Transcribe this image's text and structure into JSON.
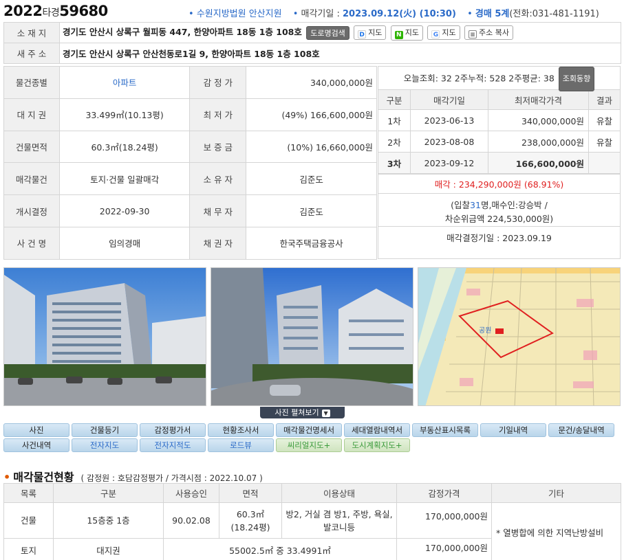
{
  "header": {
    "case_year": "2022",
    "case_type": "타경",
    "case_no": "59680",
    "court": "수원지방법원 안산지원",
    "sale_date_label": "매각기일 : ",
    "sale_date": "2023.09.12(火) (10:30)",
    "dept": "경매 5계",
    "phone": "(전화:031-481-1191)"
  },
  "address": {
    "location_label": "소 재 지",
    "location": "경기도 안산시 상록구 월피동 447, 한양아파트 18동 1층 108호",
    "btn_road": "도로명검색",
    "btn_daum": "지도",
    "btn_naver": "지도",
    "btn_google": "지도",
    "btn_copy": "주소 복사",
    "new_label": "새 주 소",
    "new_address": "경기도 안산시 상록구 안산천동로1길 9, 한양아파트 18동 1층 108호"
  },
  "info": {
    "rows": [
      {
        "l1": "물건종별",
        "v1": "아파트",
        "l2": "감 정 가",
        "v2": "340,000,000원"
      },
      {
        "l1": "대 지 권",
        "v1": "33.499㎡(10.13평)",
        "l2": "최 저 가",
        "v2": "(49%) 166,600,000원"
      },
      {
        "l1": "건물면적",
        "v1": "60.3㎡(18.24평)",
        "l2": "보 증 금",
        "v2": "(10%) 16,660,000원"
      },
      {
        "l1": "매각물건",
        "v1": "토지·건물 일괄매각",
        "l2": "소 유 자",
        "v2": "김준도"
      },
      {
        "l1": "개시결정",
        "v1": "2022-09-30",
        "l2": "채 무 자",
        "v2": "김준도"
      },
      {
        "l1": "사 건 명",
        "v1": "임의경매",
        "l2": "채 권 자",
        "v2": "한국주택금융공사"
      }
    ]
  },
  "views": {
    "text": "오늘조회: 32  2주누적: 528  2주평균: 38",
    "btn": "조회동향"
  },
  "rounds": {
    "headers": [
      "구분",
      "매각기일",
      "최저매각가격",
      "결과"
    ],
    "rows": [
      {
        "round": "1차",
        "date": "2023-06-13",
        "price": "340,000,000원",
        "result": "유찰"
      },
      {
        "round": "2차",
        "date": "2023-08-08",
        "price": "238,000,000원",
        "result": "유찰"
      },
      {
        "round": "3차",
        "date": "2023-09-12",
        "price": "166,600,000원",
        "result": ""
      }
    ]
  },
  "sale": {
    "label": "매각 : 234,290,000원",
    "ratio": "(68.91%)",
    "bid_prefix": "(입찰",
    "bid_count": "31",
    "bid_suffix": "명,매수인:강승박 /",
    "second": "차순위금액 224,530,000원)",
    "decision": "매각결정기일 : 2023.09.19"
  },
  "photo_caption": "사진 펼쳐보기",
  "map_label": "공원",
  "tabs_row1": [
    "사진",
    "건물등기",
    "감정평가서",
    "현황조사서",
    "매각물건명세서",
    "세대열람내역서",
    "부동산표시목록",
    "기일내역",
    "문건/송달내역"
  ],
  "tabs_row2": [
    "사건내역",
    "전자지도",
    "전자지적도",
    "로드뷰",
    "씨리얼지도+",
    "도시계획지도+"
  ],
  "section": {
    "title": "매각물건현황",
    "sub": "( 감정원 : 호담감정평가 / 가격시점 : 2022.10.07 )"
  },
  "goods": {
    "headers": [
      "목록",
      "구분",
      "사용승인",
      "면적",
      "이용상태",
      "감정가격",
      "기타"
    ],
    "building": {
      "kind": "건물",
      "type": "15층중 1층",
      "approved": "90.02.08",
      "area1": "60.3㎡",
      "area2": "(18.24평)",
      "use1": "방2, 거실 겸 방1, 주방, 욕실,",
      "use2": "발코니등",
      "price": "170,000,000원"
    },
    "note": "* 열병합에 의한 지역난방설비",
    "land": {
      "kind": "토지",
      "type": "대지권",
      "area": "55002.5㎡ 중 33.4991㎡",
      "price": "170,000,000원"
    }
  },
  "colors": {
    "accent_blue": "#2a6ac8",
    "sale_red": "#e02020",
    "bullet_orange": "#e05a00"
  }
}
